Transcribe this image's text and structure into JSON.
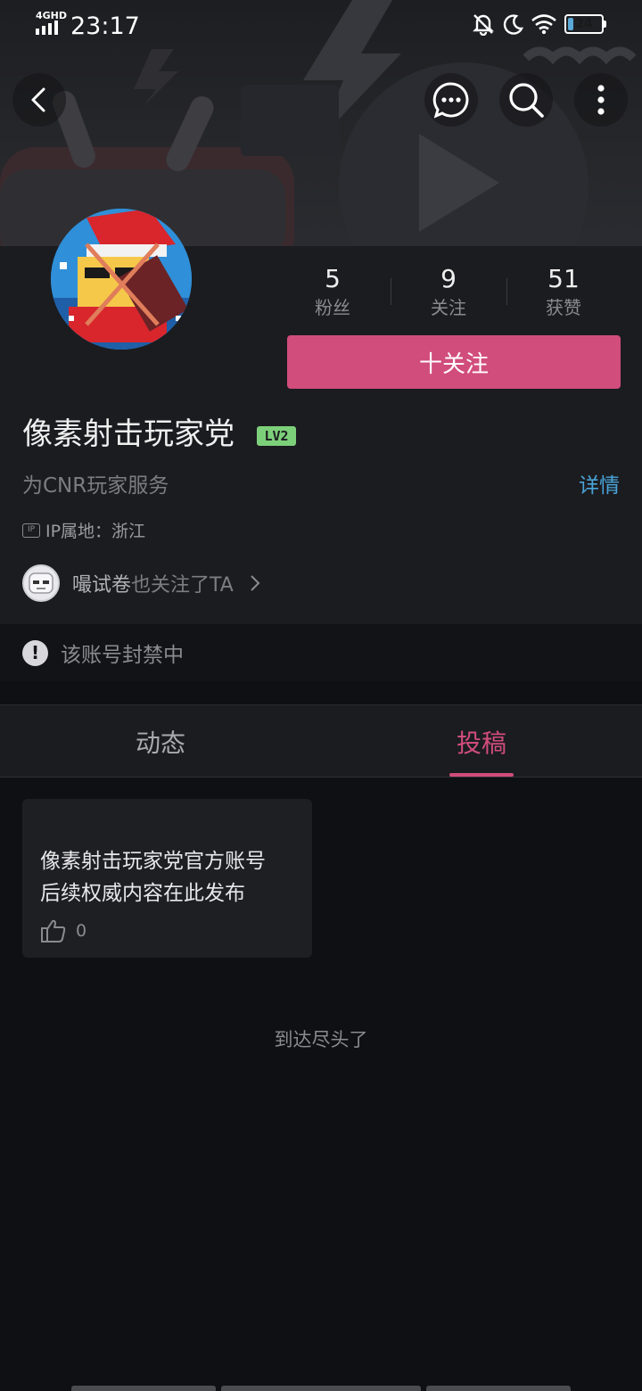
{
  "status_bar": {
    "network": "4GHD",
    "time": "23:17",
    "battery": "24",
    "battery_level_percent": 24
  },
  "nav": {
    "back_icon": "back-arrow-icon",
    "message_icon": "chat-bubble-icon",
    "search_icon": "search-icon",
    "more_icon": "more-vertical-icon"
  },
  "profile": {
    "stats": [
      {
        "value": "5",
        "label": "粉丝"
      },
      {
        "value": "9",
        "label": "关注"
      },
      {
        "value": "51",
        "label": "获赞"
      }
    ],
    "follow_label": "十关注",
    "username": "像素射击玩家党",
    "level": "LV2",
    "bio": "为CNR玩家服务",
    "details_label": "详情",
    "ip_location": "IP属地：浙江",
    "mutual_name": "嘬试卷",
    "mutual_text": "也关注了TA"
  },
  "ban_notice": "该账号封禁中",
  "tabs": [
    {
      "label": "动态",
      "active": false
    },
    {
      "label": "投稿",
      "active": true
    }
  ],
  "posts": [
    {
      "line1": "像素射击玩家党官方账号",
      "line2": "后续权威内容在此发布",
      "likes": "0"
    }
  ],
  "end_text": "到达尽头了",
  "colors": {
    "accent": "#d14d7b",
    "link": "#4aa4d8",
    "level_badge": "#7dd07a",
    "background": "#0f1013"
  }
}
